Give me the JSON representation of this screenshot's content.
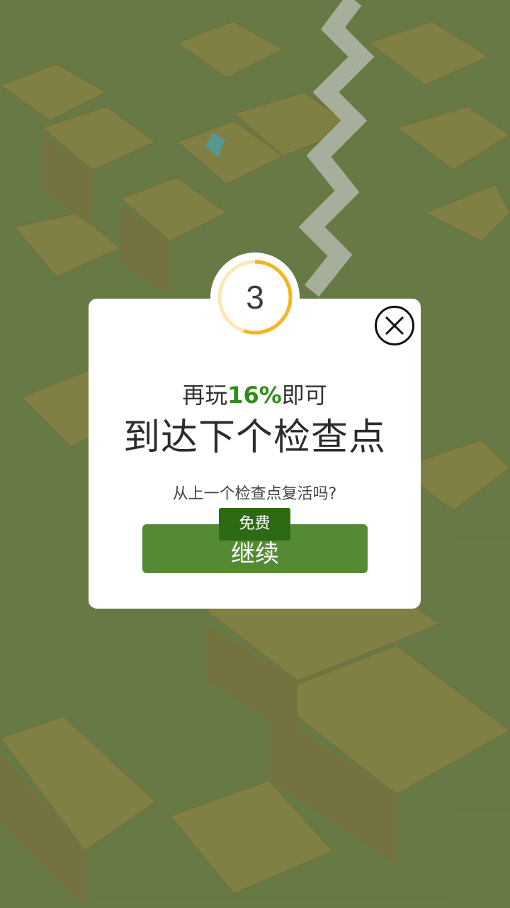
{
  "game": {
    "countdown": "3",
    "countdown_progress": 0.55
  },
  "dialog": {
    "line1_prefix": "再玩",
    "line1_percent": "16%",
    "line1_suffix": "即可",
    "line2": "到达下个检查点",
    "question": "从上一个检查点复活吗?",
    "free_badge": "免费",
    "continue_label": "继续"
  },
  "colors": {
    "accent_green": "#558a35",
    "badge_green": "#2c6b14",
    "percent_green": "#2f8c1c",
    "timer_orange": "#f4b521",
    "timer_track": "#fbe8b6"
  }
}
